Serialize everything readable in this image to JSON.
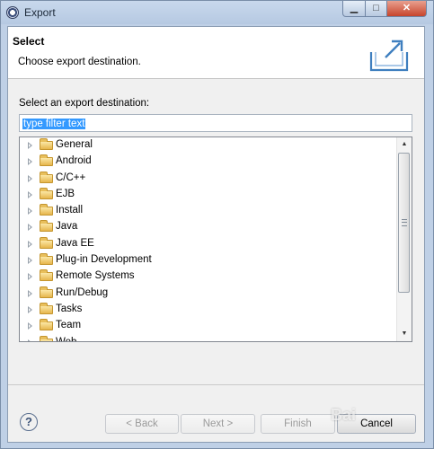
{
  "window": {
    "title": "Export"
  },
  "header": {
    "title": "Select",
    "description": "Choose export destination."
  },
  "main": {
    "section_label": "Select an export destination:",
    "filter": {
      "value": "type filter text"
    },
    "tree_items": [
      {
        "label": "General"
      },
      {
        "label": "Android"
      },
      {
        "label": "C/C++"
      },
      {
        "label": "EJB"
      },
      {
        "label": "Install"
      },
      {
        "label": "Java"
      },
      {
        "label": "Java EE"
      },
      {
        "label": "Plug-in Development"
      },
      {
        "label": "Remote Systems"
      },
      {
        "label": "Run/Debug"
      },
      {
        "label": "Tasks"
      },
      {
        "label": "Team"
      },
      {
        "label": "Web"
      }
    ]
  },
  "footer": {
    "help_label": "?",
    "back_label": "< Back",
    "next_label": "Next >",
    "finish_label": "Finish",
    "cancel_label": "Cancel"
  },
  "watermark": "Bai"
}
